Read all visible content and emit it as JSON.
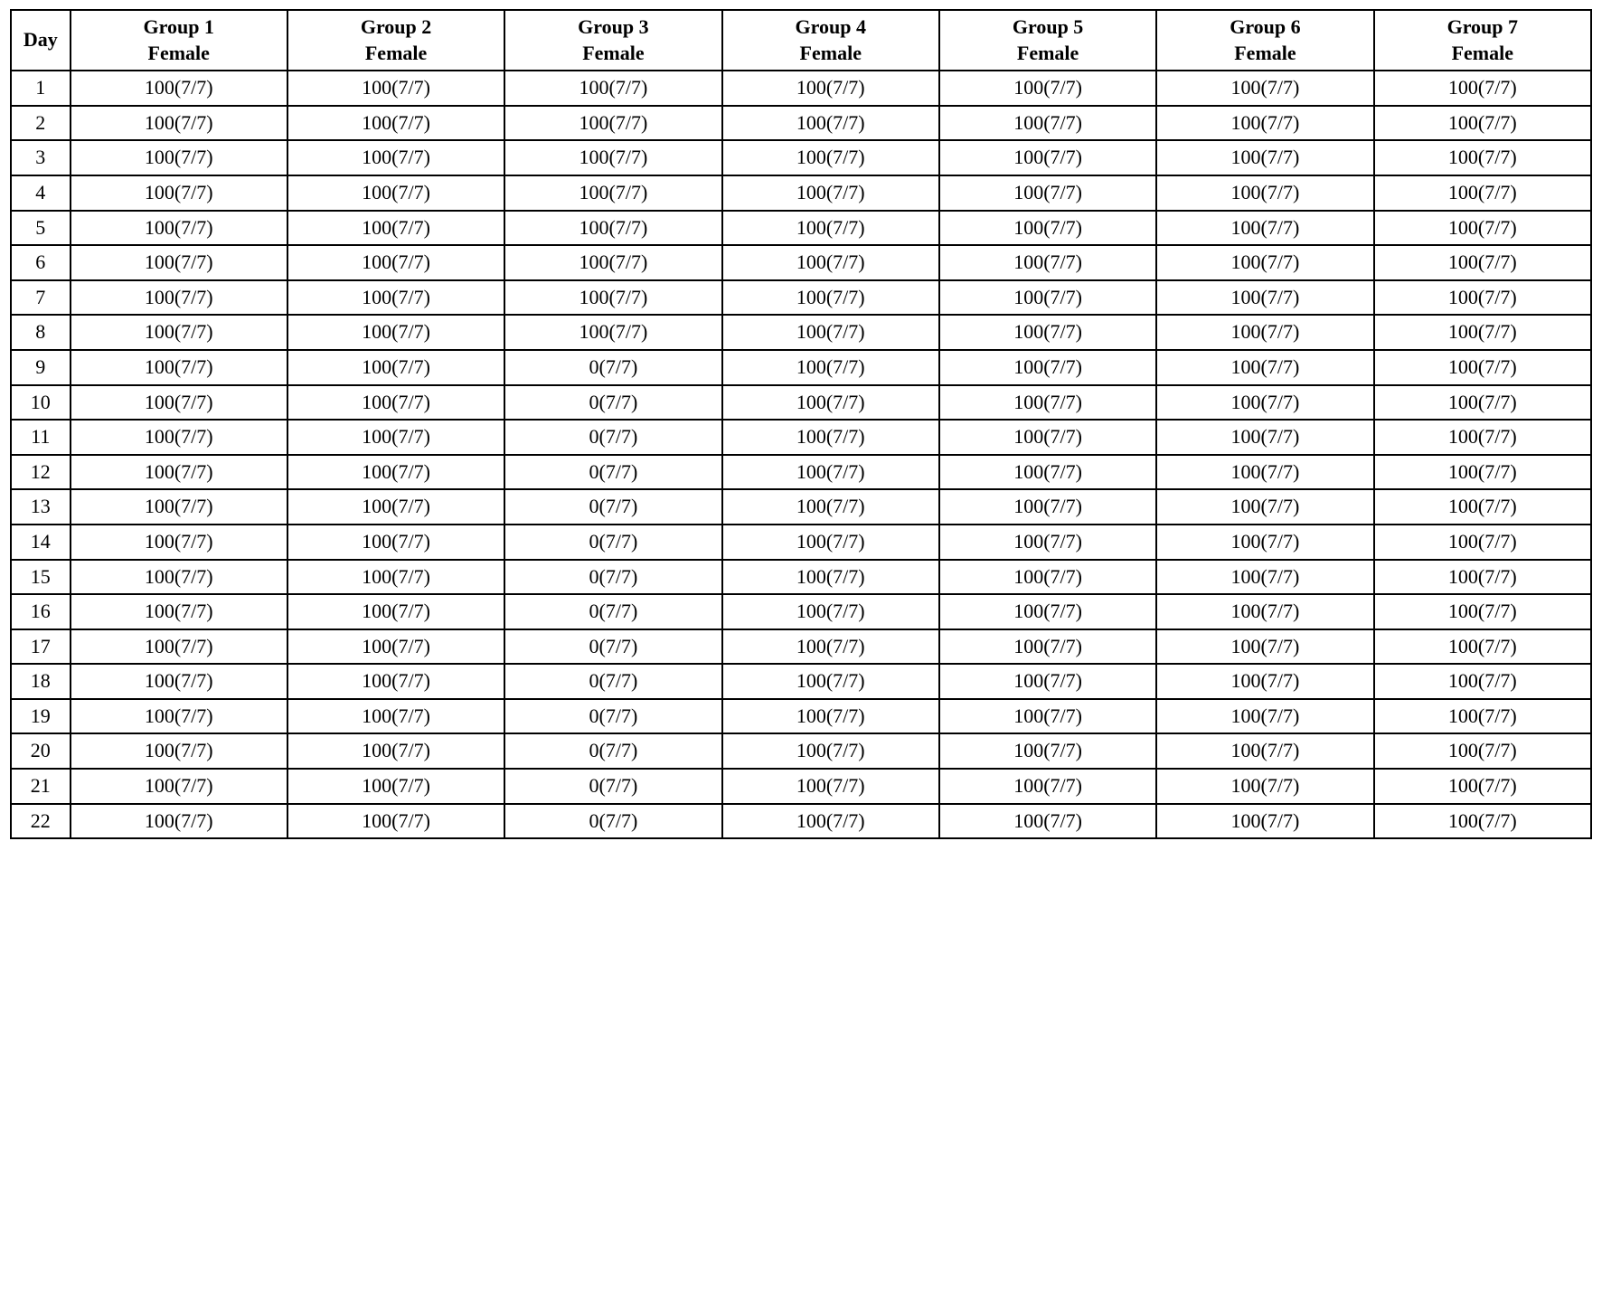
{
  "table": {
    "headers": [
      {
        "id": "day",
        "line1": "Day",
        "line2": ""
      },
      {
        "id": "group1",
        "line1": "Group 1",
        "line2": "Female"
      },
      {
        "id": "group2",
        "line1": "Group 2",
        "line2": "Female"
      },
      {
        "id": "group3",
        "line1": "Group 3",
        "line2": "Female"
      },
      {
        "id": "group4",
        "line1": "Group 4",
        "line2": "Female"
      },
      {
        "id": "group5",
        "line1": "Group 5",
        "line2": "Female"
      },
      {
        "id": "group6",
        "line1": "Group 6",
        "line2": "Female"
      },
      {
        "id": "group7",
        "line1": "Group 7",
        "line2": "Female"
      }
    ],
    "rows": [
      {
        "day": "1",
        "g1": "100(7/7)",
        "g2": "100(7/7)",
        "g3": "100(7/7)",
        "g4": "100(7/7)",
        "g5": "100(7/7)",
        "g6": "100(7/7)",
        "g7": "100(7/7)"
      },
      {
        "day": "2",
        "g1": "100(7/7)",
        "g2": "100(7/7)",
        "g3": "100(7/7)",
        "g4": "100(7/7)",
        "g5": "100(7/7)",
        "g6": "100(7/7)",
        "g7": "100(7/7)"
      },
      {
        "day": "3",
        "g1": "100(7/7)",
        "g2": "100(7/7)",
        "g3": "100(7/7)",
        "g4": "100(7/7)",
        "g5": "100(7/7)",
        "g6": "100(7/7)",
        "g7": "100(7/7)"
      },
      {
        "day": "4",
        "g1": "100(7/7)",
        "g2": "100(7/7)",
        "g3": "100(7/7)",
        "g4": "100(7/7)",
        "g5": "100(7/7)",
        "g6": "100(7/7)",
        "g7": "100(7/7)"
      },
      {
        "day": "5",
        "g1": "100(7/7)",
        "g2": "100(7/7)",
        "g3": "100(7/7)",
        "g4": "100(7/7)",
        "g5": "100(7/7)",
        "g6": "100(7/7)",
        "g7": "100(7/7)"
      },
      {
        "day": "6",
        "g1": "100(7/7)",
        "g2": "100(7/7)",
        "g3": "100(7/7)",
        "g4": "100(7/7)",
        "g5": "100(7/7)",
        "g6": "100(7/7)",
        "g7": "100(7/7)"
      },
      {
        "day": "7",
        "g1": "100(7/7)",
        "g2": "100(7/7)",
        "g3": "100(7/7)",
        "g4": "100(7/7)",
        "g5": "100(7/7)",
        "g6": "100(7/7)",
        "g7": "100(7/7)"
      },
      {
        "day": "8",
        "g1": "100(7/7)",
        "g2": "100(7/7)",
        "g3": "100(7/7)",
        "g4": "100(7/7)",
        "g5": "100(7/7)",
        "g6": "100(7/7)",
        "g7": "100(7/7)"
      },
      {
        "day": "9",
        "g1": "100(7/7)",
        "g2": "100(7/7)",
        "g3": "0(7/7)",
        "g4": "100(7/7)",
        "g5": "100(7/7)",
        "g6": "100(7/7)",
        "g7": "100(7/7)"
      },
      {
        "day": "10",
        "g1": "100(7/7)",
        "g2": "100(7/7)",
        "g3": "0(7/7)",
        "g4": "100(7/7)",
        "g5": "100(7/7)",
        "g6": "100(7/7)",
        "g7": "100(7/7)"
      },
      {
        "day": "11",
        "g1": "100(7/7)",
        "g2": "100(7/7)",
        "g3": "0(7/7)",
        "g4": "100(7/7)",
        "g5": "100(7/7)",
        "g6": "100(7/7)",
        "g7": "100(7/7)"
      },
      {
        "day": "12",
        "g1": "100(7/7)",
        "g2": "100(7/7)",
        "g3": "0(7/7)",
        "g4": "100(7/7)",
        "g5": "100(7/7)",
        "g6": "100(7/7)",
        "g7": "100(7/7)"
      },
      {
        "day": "13",
        "g1": "100(7/7)",
        "g2": "100(7/7)",
        "g3": "0(7/7)",
        "g4": "100(7/7)",
        "g5": "100(7/7)",
        "g6": "100(7/7)",
        "g7": "100(7/7)"
      },
      {
        "day": "14",
        "g1": "100(7/7)",
        "g2": "100(7/7)",
        "g3": "0(7/7)",
        "g4": "100(7/7)",
        "g5": "100(7/7)",
        "g6": "100(7/7)",
        "g7": "100(7/7)"
      },
      {
        "day": "15",
        "g1": "100(7/7)",
        "g2": "100(7/7)",
        "g3": "0(7/7)",
        "g4": "100(7/7)",
        "g5": "100(7/7)",
        "g6": "100(7/7)",
        "g7": "100(7/7)"
      },
      {
        "day": "16",
        "g1": "100(7/7)",
        "g2": "100(7/7)",
        "g3": "0(7/7)",
        "g4": "100(7/7)",
        "g5": "100(7/7)",
        "g6": "100(7/7)",
        "g7": "100(7/7)"
      },
      {
        "day": "17",
        "g1": "100(7/7)",
        "g2": "100(7/7)",
        "g3": "0(7/7)",
        "g4": "100(7/7)",
        "g5": "100(7/7)",
        "g6": "100(7/7)",
        "g7": "100(7/7)"
      },
      {
        "day": "18",
        "g1": "100(7/7)",
        "g2": "100(7/7)",
        "g3": "0(7/7)",
        "g4": "100(7/7)",
        "g5": "100(7/7)",
        "g6": "100(7/7)",
        "g7": "100(7/7)"
      },
      {
        "day": "19",
        "g1": "100(7/7)",
        "g2": "100(7/7)",
        "g3": "0(7/7)",
        "g4": "100(7/7)",
        "g5": "100(7/7)",
        "g6": "100(7/7)",
        "g7": "100(7/7)"
      },
      {
        "day": "20",
        "g1": "100(7/7)",
        "g2": "100(7/7)",
        "g3": "0(7/7)",
        "g4": "100(7/7)",
        "g5": "100(7/7)",
        "g6": "100(7/7)",
        "g7": "100(7/7)"
      },
      {
        "day": "21",
        "g1": "100(7/7)",
        "g2": "100(7/7)",
        "g3": "0(7/7)",
        "g4": "100(7/7)",
        "g5": "100(7/7)",
        "g6": "100(7/7)",
        "g7": "100(7/7)"
      },
      {
        "day": "22",
        "g1": "100(7/7)",
        "g2": "100(7/7)",
        "g3": "0(7/7)",
        "g4": "100(7/7)",
        "g5": "100(7/7)",
        "g6": "100(7/7)",
        "g7": "100(7/7)"
      }
    ]
  }
}
